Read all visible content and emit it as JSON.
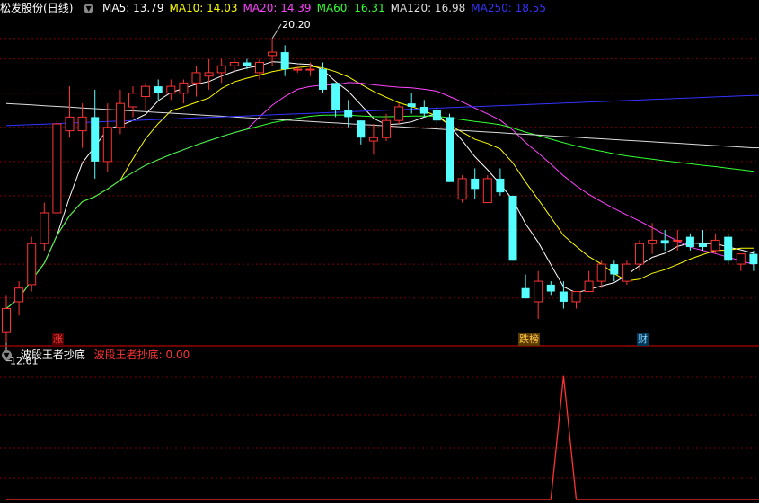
{
  "stock": {
    "name": "松发股份",
    "period": "(日线)"
  },
  "ma_labels": [
    {
      "text": "MA5: 13.79",
      "color": "#ffffff"
    },
    {
      "text": "MA10: 14.03",
      "color": "#ffff00"
    },
    {
      "text": "MA20: 14.39",
      "color": "#ff44ff"
    },
    {
      "text": "MA60: 16.31",
      "color": "#33ff33"
    },
    {
      "text": "MA120: 16.98",
      "color": "#dddddd"
    },
    {
      "text": "MA250: 18.55",
      "color": "#3333ff"
    }
  ],
  "price_annotations": {
    "high": "20.20",
    "low": "12.61"
  },
  "badges": {
    "rise": "涨",
    "fall_list": "跌榜",
    "finance": "财"
  },
  "indicator": {
    "name": "波段王者抄底",
    "value_label": "波段王者抄底: 0.00",
    "value_color": "#ff3333"
  },
  "colors": {
    "up": "#ff3333",
    "down": "#55ffff",
    "grid": "#7a0000",
    "divider": "#b00000"
  },
  "chart_data": [
    {
      "type": "candlestick",
      "title": "松发股份 (日线)",
      "series": [
        {
          "name": "K",
          "values": [
            [
              11.6,
              12.7,
              11.3,
              12.3
            ],
            [
              12.5,
              13.1,
              12.1,
              12.9
            ],
            [
              13.0,
              14.4,
              12.8,
              14.2
            ],
            [
              14.2,
              15.4,
              14.0,
              15.1
            ],
            [
              15.1,
              17.8,
              15.0,
              17.7
            ],
            [
              17.5,
              18.8,
              17.3,
              17.9
            ],
            [
              17.5,
              18.3,
              17.0,
              17.9
            ],
            [
              17.9,
              18.7,
              16.1,
              16.6
            ],
            [
              16.6,
              18.3,
              16.3,
              17.6
            ],
            [
              17.6,
              18.7,
              17.4,
              18.3
            ],
            [
              18.2,
              18.8,
              17.9,
              18.6
            ],
            [
              18.5,
              18.9,
              18.1,
              18.8
            ],
            [
              18.8,
              19.0,
              18.4,
              18.6
            ],
            [
              18.6,
              19.0,
              18.4,
              18.8
            ],
            [
              18.6,
              19.0,
              18.3,
              18.9
            ],
            [
              18.9,
              19.4,
              18.5,
              19.2
            ],
            [
              19.1,
              19.6,
              18.7,
              19.2
            ],
            [
              19.2,
              19.6,
              18.9,
              19.4
            ],
            [
              19.4,
              19.6,
              19.2,
              19.5
            ],
            [
              19.5,
              19.6,
              19.3,
              19.4
            ],
            [
              19.2,
              19.6,
              19.0,
              19.5
            ],
            [
              19.7,
              20.2,
              19.4,
              19.8
            ],
            [
              19.8,
              20.0,
              19.1,
              19.3
            ],
            [
              19.3,
              19.4,
              19.2,
              19.3
            ],
            [
              19.3,
              19.5,
              19.1,
              19.3
            ],
            [
              19.3,
              19.5,
              18.6,
              18.7
            ],
            [
              18.9,
              18.9,
              17.9,
              18.1
            ],
            [
              18.1,
              18.4,
              17.6,
              17.9
            ],
            [
              17.8,
              17.8,
              17.1,
              17.3
            ],
            [
              17.2,
              17.7,
              16.8,
              17.3
            ],
            [
              17.3,
              18.0,
              17.2,
              17.8
            ],
            [
              17.8,
              18.3,
              17.7,
              18.2
            ],
            [
              18.3,
              18.6,
              18.0,
              18.2
            ],
            [
              18.2,
              18.4,
              17.9,
              18.0
            ],
            [
              18.1,
              18.2,
              17.7,
              17.8
            ],
            [
              17.9,
              18.0,
              16.0,
              16.0
            ],
            [
              15.5,
              16.2,
              15.4,
              16.1
            ],
            [
              16.1,
              16.4,
              15.5,
              15.8
            ],
            [
              15.4,
              16.2,
              15.4,
              16.1
            ],
            [
              16.1,
              16.4,
              15.6,
              15.7
            ],
            [
              15.6,
              15.6,
              13.7,
              13.7
            ],
            [
              12.9,
              13.3,
              12.6,
              12.6
            ],
            [
              12.5,
              13.4,
              12.0,
              13.1
            ],
            [
              13.0,
              13.1,
              12.7,
              12.8
            ],
            [
              12.8,
              13.1,
              12.3,
              12.5
            ],
            [
              12.5,
              12.8,
              12.3,
              12.8
            ],
            [
              12.8,
              13.4,
              12.8,
              13.1
            ],
            [
              13.1,
              13.7,
              12.9,
              13.6
            ],
            [
              13.6,
              13.7,
              13.1,
              13.3
            ],
            [
              13.1,
              13.7,
              13.0,
              13.6
            ],
            [
              13.6,
              14.3,
              13.4,
              14.2
            ],
            [
              14.2,
              14.8,
              13.9,
              14.3
            ],
            [
              14.3,
              14.6,
              14.0,
              14.2
            ],
            [
              14.3,
              14.6,
              14.0,
              14.3
            ],
            [
              14.4,
              14.5,
              14.0,
              14.1
            ],
            [
              14.2,
              14.6,
              14.0,
              14.1
            ],
            [
              14.0,
              14.5,
              13.9,
              14.3
            ],
            [
              14.4,
              14.5,
              13.6,
              13.7
            ],
            [
              13.6,
              13.9,
              13.4,
              13.9
            ],
            [
              13.9,
              14.0,
              13.4,
              13.6
            ]
          ]
        }
      ],
      "ylim": [
        11.5,
        20.8
      ],
      "yticks": [
        12.61,
        13.6,
        14.6,
        15.6,
        16.6,
        17.6,
        18.6,
        19.6,
        20.2
      ]
    },
    {
      "type": "line",
      "title": "波段王者抄底",
      "series": [
        {
          "name": "波段王者抄底",
          "values": [
            0,
            0,
            0,
            0,
            0,
            0,
            0,
            0,
            0,
            0,
            0,
            0,
            0,
            0,
            0,
            0,
            0,
            0,
            0,
            0,
            0,
            0,
            0,
            0,
            0,
            0,
            0,
            0,
            0,
            0,
            0,
            0,
            0,
            0,
            0,
            0,
            0,
            0,
            0,
            0,
            0,
            0,
            0,
            0,
            1,
            0,
            0,
            0,
            0,
            0,
            0,
            0,
            0,
            0,
            0,
            0,
            0,
            0,
            0,
            0
          ]
        }
      ],
      "ylim": [
        0,
        1.1
      ]
    }
  ]
}
